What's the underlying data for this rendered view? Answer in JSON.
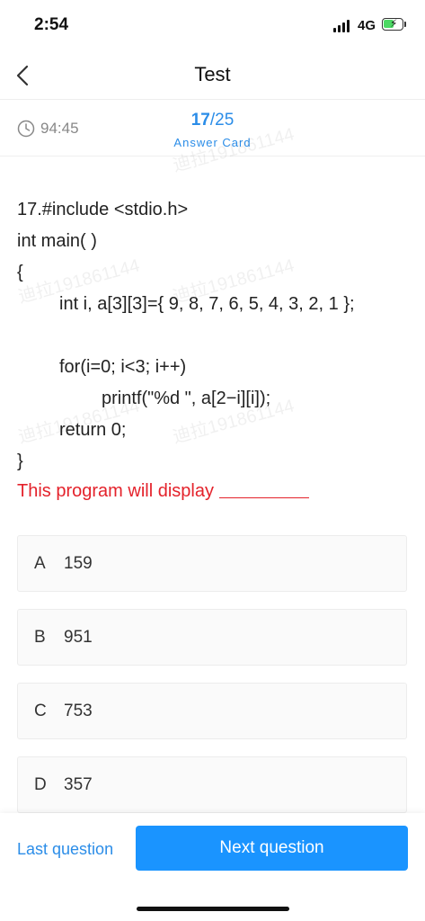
{
  "status_bar": {
    "time": "2:54",
    "network": "4G"
  },
  "nav": {
    "title": "Test"
  },
  "info": {
    "timer": "94:45",
    "current": "17",
    "separator": "/",
    "total": "25",
    "answer_card": "Answer Card"
  },
  "question": {
    "lines": [
      "17.#include <stdio.h>",
      "int main( )",
      "{",
      "int i, a[3][3]={ 9, 8, 7, 6, 5, 4, 3, 2, 1 };",
      "for(i=0; i<3; i++)",
      "printf(\"%d \", a[2−i][i]);",
      "return 0;",
      "}"
    ],
    "prompt": "This program will display"
  },
  "watermark": "迪拉191861144",
  "options": [
    {
      "letter": "A",
      "text": "159"
    },
    {
      "letter": "B",
      "text": "951"
    },
    {
      "letter": "C",
      "text": "753"
    },
    {
      "letter": "D",
      "text": "357"
    }
  ],
  "footer": {
    "last_label": "Last question",
    "next_label": "Next question"
  },
  "colors": {
    "accent": "#1a94ff",
    "link": "#2b8de8",
    "prompt": "#e4222b"
  }
}
